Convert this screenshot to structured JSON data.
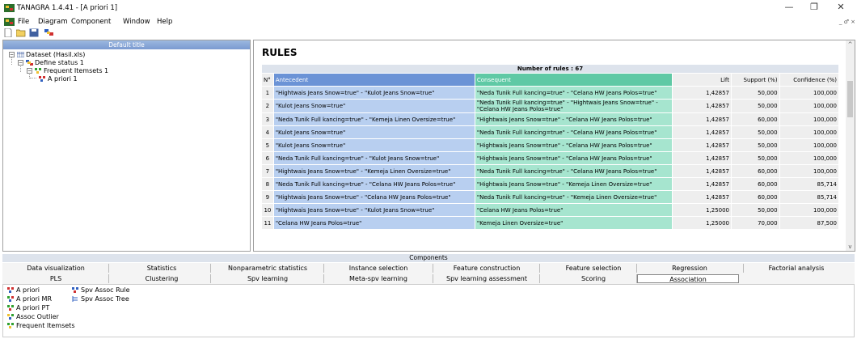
{
  "window": {
    "title": "TANAGRA 1.4.41 - [A priori 1]",
    "minimize": "—",
    "maximize": "❐",
    "close": "✕"
  },
  "menu": {
    "items": [
      "File",
      "Diagram",
      "Component",
      "Window",
      "Help"
    ],
    "mdi_controls": "_ ♂ ×"
  },
  "left_panel": {
    "header": "Default title",
    "tree": [
      {
        "label": "Dataset (Hasil.xls)",
        "toggle": "−"
      },
      {
        "label": "Define status 1",
        "toggle": "−"
      },
      {
        "label": "Frequent Itemsets 1",
        "toggle": "−"
      },
      {
        "label": "A priori 1"
      }
    ]
  },
  "rules": {
    "title": "RULES",
    "count_label": "Number of rules : 67",
    "columns": [
      "N°",
      "Antecedent",
      "Consequent",
      "Lift",
      "Support (%)",
      "Confidence (%)"
    ],
    "rows": [
      {
        "n": "1",
        "ant": "\"Hightwais Jeans Snow=true\" - \"Kulot Jeans Snow=true\"",
        "cons": "\"Neda Tunik Full kancing=true\" - \"Celana HW Jeans Polos=true\"",
        "lift": "1,42857",
        "support": "50,000",
        "confidence": "100,000"
      },
      {
        "n": "2",
        "ant": "\"Kulot Jeans Snow=true\"",
        "cons": "\"Neda Tunik Full kancing=true\" - \"Hightwais Jeans Snow=true\" - \"Celana HW Jeans Polos=true\"",
        "lift": "1,42857",
        "support": "50,000",
        "confidence": "100,000"
      },
      {
        "n": "3",
        "ant": "\"Neda Tunik Full kancing=true\" - \"Kemeja Linen Oversize=true\"",
        "cons": "\"Hightwais Jeans Snow=true\" - \"Celana HW Jeans Polos=true\"",
        "lift": "1,42857",
        "support": "60,000",
        "confidence": "100,000"
      },
      {
        "n": "4",
        "ant": "\"Kulot Jeans Snow=true\"",
        "cons": "\"Neda Tunik Full kancing=true\" - \"Celana HW Jeans Polos=true\"",
        "lift": "1,42857",
        "support": "50,000",
        "confidence": "100,000"
      },
      {
        "n": "5",
        "ant": "\"Kulot Jeans Snow=true\"",
        "cons": "\"Hightwais Jeans Snow=true\" - \"Celana HW Jeans Polos=true\"",
        "lift": "1,42857",
        "support": "50,000",
        "confidence": "100,000"
      },
      {
        "n": "6",
        "ant": "\"Neda Tunik Full kancing=true\" - \"Kulot Jeans Snow=true\"",
        "cons": "\"Hightwais Jeans Snow=true\" - \"Celana HW Jeans Polos=true\"",
        "lift": "1,42857",
        "support": "50,000",
        "confidence": "100,000"
      },
      {
        "n": "7",
        "ant": "\"Hightwais Jeans Snow=true\" - \"Kemeja Linen Oversize=true\"",
        "cons": "\"Neda Tunik Full kancing=true\" - \"Celana HW Jeans Polos=true\"",
        "lift": "1,42857",
        "support": "60,000",
        "confidence": "100,000"
      },
      {
        "n": "8",
        "ant": "\"Neda Tunik Full kancing=true\" - \"Celana HW Jeans Polos=true\"",
        "cons": "\"Hightwais Jeans Snow=true\" - \"Kemeja Linen Oversize=true\"",
        "lift": "1,42857",
        "support": "60,000",
        "confidence": "85,714"
      },
      {
        "n": "9",
        "ant": "\"Hightwais Jeans Snow=true\" - \"Celana HW Jeans Polos=true\"",
        "cons": "\"Neda Tunik Full kancing=true\" - \"Kemeja Linen Oversize=true\"",
        "lift": "1,42857",
        "support": "60,000",
        "confidence": "85,714"
      },
      {
        "n": "10",
        "ant": "\"Hightwais Jeans Snow=true\" - \"Kulot Jeans Snow=true\"",
        "cons": "\"Celana HW Jeans Polos=true\"",
        "lift": "1,25000",
        "support": "50,000",
        "confidence": "100,000"
      },
      {
        "n": "11",
        "ant": "\"Celana HW Jeans Polos=true\"",
        "cons": "\"Kemeja Linen Oversize=true\"",
        "lift": "1,25000",
        "support": "70,000",
        "confidence": "87,500"
      }
    ]
  },
  "components": {
    "header": "Components",
    "tabs_row1": [
      "Data visualization",
      "Statistics",
      "Nonparametric statistics",
      "Instance selection",
      "Feature construction",
      "Feature selection",
      "Regression",
      "Factorial analysis"
    ],
    "tabs_row2": [
      "PLS",
      "Clustering",
      "Spv learning",
      "Meta-spv learning",
      "Spv learning assessment",
      "Scoring",
      "Association"
    ],
    "active_tab": "Association",
    "items_col1": [
      "A priori",
      "A priori MR",
      "A priori PT",
      "Assoc Outlier",
      "Frequent Itemsets"
    ],
    "items_col2": [
      "Spv Assoc Rule",
      "Spv Assoc Tree"
    ]
  }
}
